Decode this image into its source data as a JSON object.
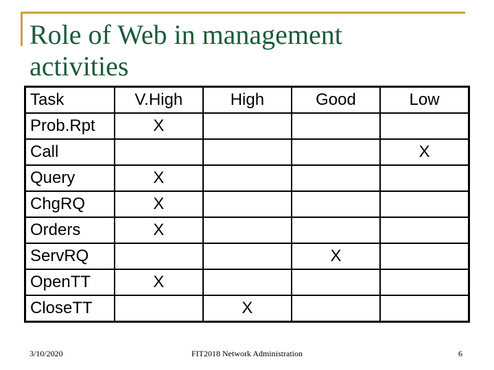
{
  "title": "Role of Web in management activities",
  "table": {
    "headers": [
      "Task",
      "V.High",
      "High",
      "Good",
      "Low"
    ],
    "rows": [
      {
        "task": "Prob.Rpt",
        "cells": [
          "X",
          "",
          "",
          ""
        ]
      },
      {
        "task": "Call",
        "cells": [
          "",
          "",
          "",
          "X"
        ]
      },
      {
        "task": "Query",
        "cells": [
          "X",
          "",
          "",
          ""
        ]
      },
      {
        "task": "ChgRQ",
        "cells": [
          "X",
          "",
          "",
          ""
        ]
      },
      {
        "task": "Orders",
        "cells": [
          "X",
          "",
          "",
          ""
        ]
      },
      {
        "task": "ServRQ",
        "cells": [
          "",
          "",
          "X",
          ""
        ]
      },
      {
        "task": "OpenTT",
        "cells": [
          "X",
          "",
          "",
          ""
        ]
      },
      {
        "task": "CloseTT",
        "cells": [
          "",
          "X",
          "",
          ""
        ]
      }
    ]
  },
  "footer": {
    "date": "3/10/2020",
    "course": "FIT2018 Network Administration",
    "page": "6"
  },
  "colors": {
    "accent": "#c8a43a",
    "title": "#1a5b3a"
  }
}
